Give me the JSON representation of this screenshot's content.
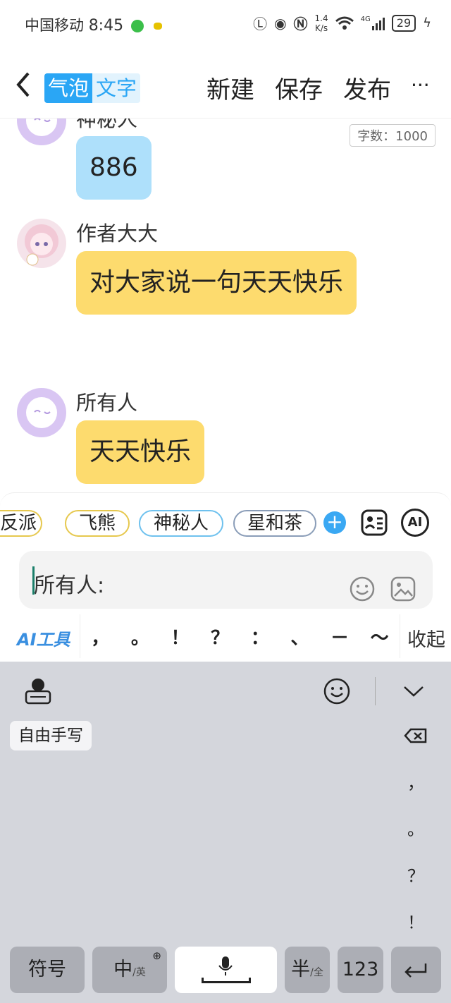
{
  "status": {
    "carrier": "中国移动",
    "time": "8:45",
    "speed_top": "1.4",
    "speed_bottom": "K/s",
    "network": "4G",
    "battery": "29"
  },
  "nav": {
    "tab_bubble": "气泡",
    "tab_text": "文字",
    "new_label": "新建",
    "save_label": "保存",
    "publish_label": "发布",
    "more_label": "···"
  },
  "chat": {
    "word_count": "字数：1000",
    "messages": [
      {
        "name": "神秘人",
        "text": "886",
        "color": "#aee0fb"
      },
      {
        "name": "作者大大",
        "text": "对大家说一句天天快乐",
        "color": "#fddb6e"
      },
      {
        "name": "所有人",
        "text": "天天快乐",
        "color": "#fddb6e"
      }
    ]
  },
  "compose": {
    "chips": [
      "反派",
      "飞熊",
      "神秘人",
      "星和茶"
    ],
    "ai_label": "AI",
    "input_value": "所有人:",
    "ai_tools_label": "AI工具",
    "punctuation": [
      "，",
      "。",
      "！",
      "？",
      "：",
      "、",
      "－",
      "～"
    ],
    "collapse_label": "收起"
  },
  "keyboard": {
    "handwriting_label": "自由手写",
    "side_punct": [
      "，",
      "。",
      "？",
      "！"
    ],
    "symbol_label": "符号",
    "zh_label": "中",
    "en_sub": "/英",
    "half_label": "半",
    "full_sub": "/全",
    "num_label": "123"
  },
  "colors": {
    "accent": "#2aa6f5",
    "bubble_blue": "#aee0fb",
    "bubble_yellow": "#fddb6e",
    "keyboard_bg": "#d4d6dc"
  }
}
